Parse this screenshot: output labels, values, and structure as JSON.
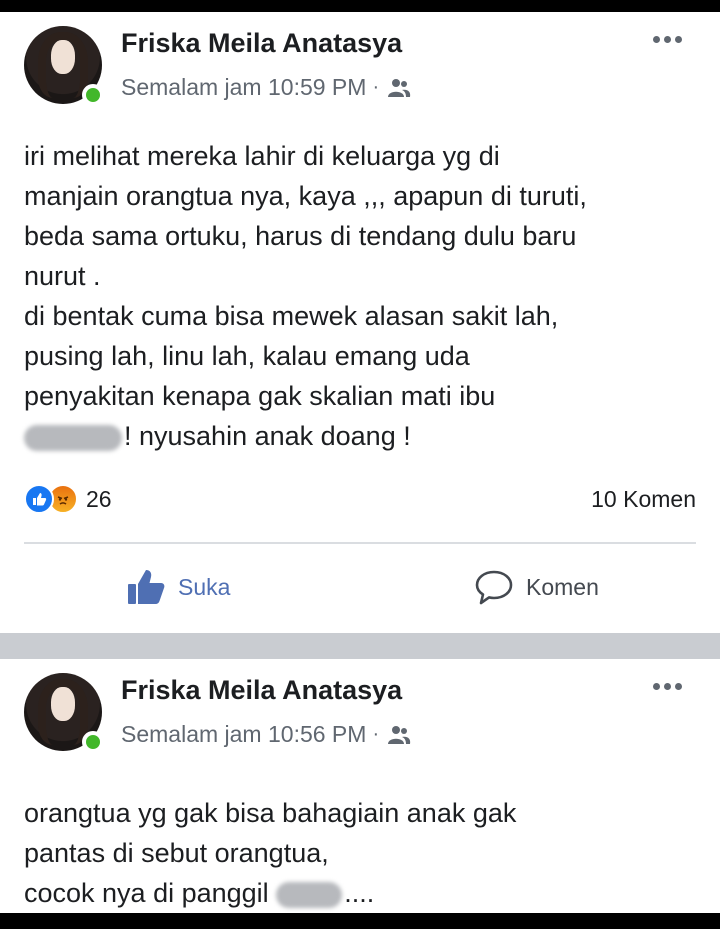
{
  "post1": {
    "author": "Friska Meila Anatasya",
    "time": "Semalam jam 10:59 PM",
    "separator": "·",
    "lines": [
      "iri melihat mereka lahir di keluarga yg di",
      "manjain orangtua nya, kaya ,,, apapun di turuti,",
      "beda sama ortuku, harus di tendang dulu baru",
      "nurut .",
      "di bentak cuma bisa mewek alasan sakit lah,",
      "pusing lah, linu lah, kalau emang uda",
      "penyakitan kenapa gak skalian mati ibu"
    ],
    "last_line_after_censor": "! nyusahin anak doang !",
    "reaction_count": "26",
    "comment_count": "10 Komen",
    "like_label": "Suka",
    "comment_label": "Komen"
  },
  "post2": {
    "author": "Friska Meila Anatasya",
    "time": "Semalam jam 10:56 PM",
    "separator": "·",
    "lines": [
      "orangtua yg gak bisa bahagiain anak gak",
      "pantas di sebut orangtua,"
    ],
    "last_line_before_censor": "cocok nya di panggil",
    "last_line_after_censor": "...."
  },
  "colors": {
    "like_blue": "#1877f2",
    "online_green": "#42b72a",
    "separator_gray": "#c9ccd1"
  },
  "icons": [
    "more-options-icon",
    "friends-audience-icon",
    "like-reaction-icon",
    "angry-reaction-icon",
    "thumbs-up-icon",
    "comment-bubble-icon"
  ]
}
